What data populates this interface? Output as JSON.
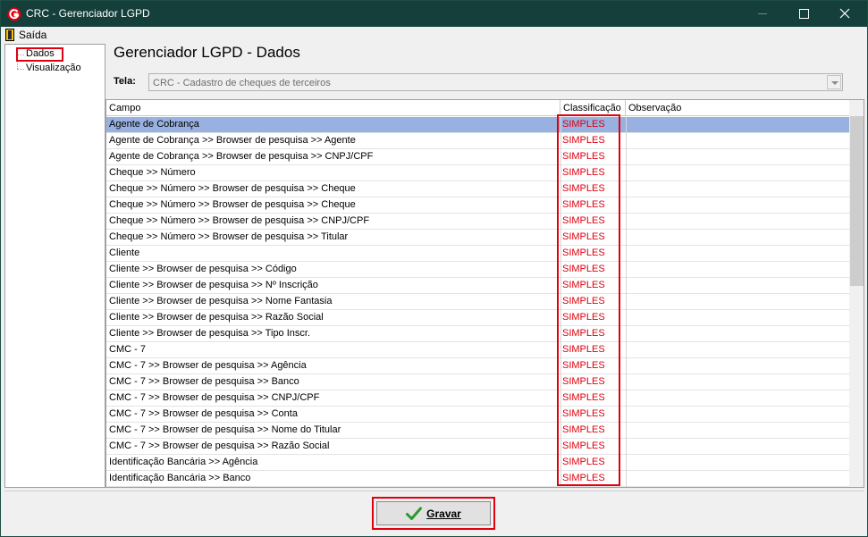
{
  "window": {
    "title": "CRC - Gerenciador LGPD",
    "accent": "#143f3a"
  },
  "menu": {
    "exit_label": "Saída"
  },
  "tree": {
    "items": [
      {
        "label": "Dados",
        "selected": true
      },
      {
        "label": "Visualização",
        "selected": false
      }
    ]
  },
  "main": {
    "title": "Gerenciador LGPD - Dados",
    "tela_label": "Tela:",
    "tela_value": "CRC - Cadastro de cheques de terceiros"
  },
  "grid": {
    "columns": [
      "Campo",
      "Classificação",
      "Observação"
    ],
    "rows": [
      {
        "campo": "Agente de Cobrança",
        "classificacao": "SIMPLES",
        "observacao": ""
      },
      {
        "campo": "Agente de Cobrança >> Browser de pesquisa >> Agente",
        "classificacao": "SIMPLES",
        "observacao": ""
      },
      {
        "campo": "Agente de Cobrança >> Browser de pesquisa >> CNPJ/CPF",
        "classificacao": "SIMPLES",
        "observacao": ""
      },
      {
        "campo": "Cheque >> Número",
        "classificacao": "SIMPLES",
        "observacao": ""
      },
      {
        "campo": "Cheque >> Número >> Browser de pesquisa >> Cheque",
        "classificacao": "SIMPLES",
        "observacao": ""
      },
      {
        "campo": "Cheque >> Número >> Browser de pesquisa >> Cheque",
        "classificacao": "SIMPLES",
        "observacao": ""
      },
      {
        "campo": "Cheque >> Número >> Browser de pesquisa >> CNPJ/CPF",
        "classificacao": "SIMPLES",
        "observacao": ""
      },
      {
        "campo": "Cheque >> Número >> Browser de pesquisa >> Titular",
        "classificacao": "SIMPLES",
        "observacao": ""
      },
      {
        "campo": "Cliente",
        "classificacao": "SIMPLES",
        "observacao": ""
      },
      {
        "campo": "Cliente >> Browser de pesquisa >> Código",
        "classificacao": "SIMPLES",
        "observacao": ""
      },
      {
        "campo": "Cliente >> Browser de pesquisa >> Nº Inscrição",
        "classificacao": "SIMPLES",
        "observacao": ""
      },
      {
        "campo": "Cliente >> Browser de pesquisa >> Nome Fantasia",
        "classificacao": "SIMPLES",
        "observacao": ""
      },
      {
        "campo": "Cliente >> Browser de pesquisa >> Razão Social",
        "classificacao": "SIMPLES",
        "observacao": ""
      },
      {
        "campo": "Cliente >> Browser de pesquisa >> Tipo Inscr.",
        "classificacao": "SIMPLES",
        "observacao": ""
      },
      {
        "campo": "CMC - 7",
        "classificacao": "SIMPLES",
        "observacao": ""
      },
      {
        "campo": "CMC - 7 >> Browser de pesquisa >> Agência",
        "classificacao": "SIMPLES",
        "observacao": ""
      },
      {
        "campo": "CMC - 7 >> Browser de pesquisa >> Banco",
        "classificacao": "SIMPLES",
        "observacao": ""
      },
      {
        "campo": "CMC - 7 >> Browser de pesquisa >> CNPJ/CPF",
        "classificacao": "SIMPLES",
        "observacao": ""
      },
      {
        "campo": "CMC - 7 >> Browser de pesquisa >> Conta",
        "classificacao": "SIMPLES",
        "observacao": ""
      },
      {
        "campo": "CMC - 7 >> Browser de pesquisa >> Nome do Titular",
        "classificacao": "SIMPLES",
        "observacao": ""
      },
      {
        "campo": "CMC - 7 >> Browser de pesquisa >> Razão Social",
        "classificacao": "SIMPLES",
        "observacao": ""
      },
      {
        "campo": "Identificação Bancária >> Agência",
        "classificacao": "SIMPLES",
        "observacao": ""
      },
      {
        "campo": "Identificação Bancária >> Banco",
        "classificacao": "SIMPLES",
        "observacao": ""
      }
    ],
    "selected_row": 0,
    "selected_color": "#98b1e1",
    "classification_color": "#e0000f"
  },
  "footer": {
    "save_label": "Gravar"
  }
}
